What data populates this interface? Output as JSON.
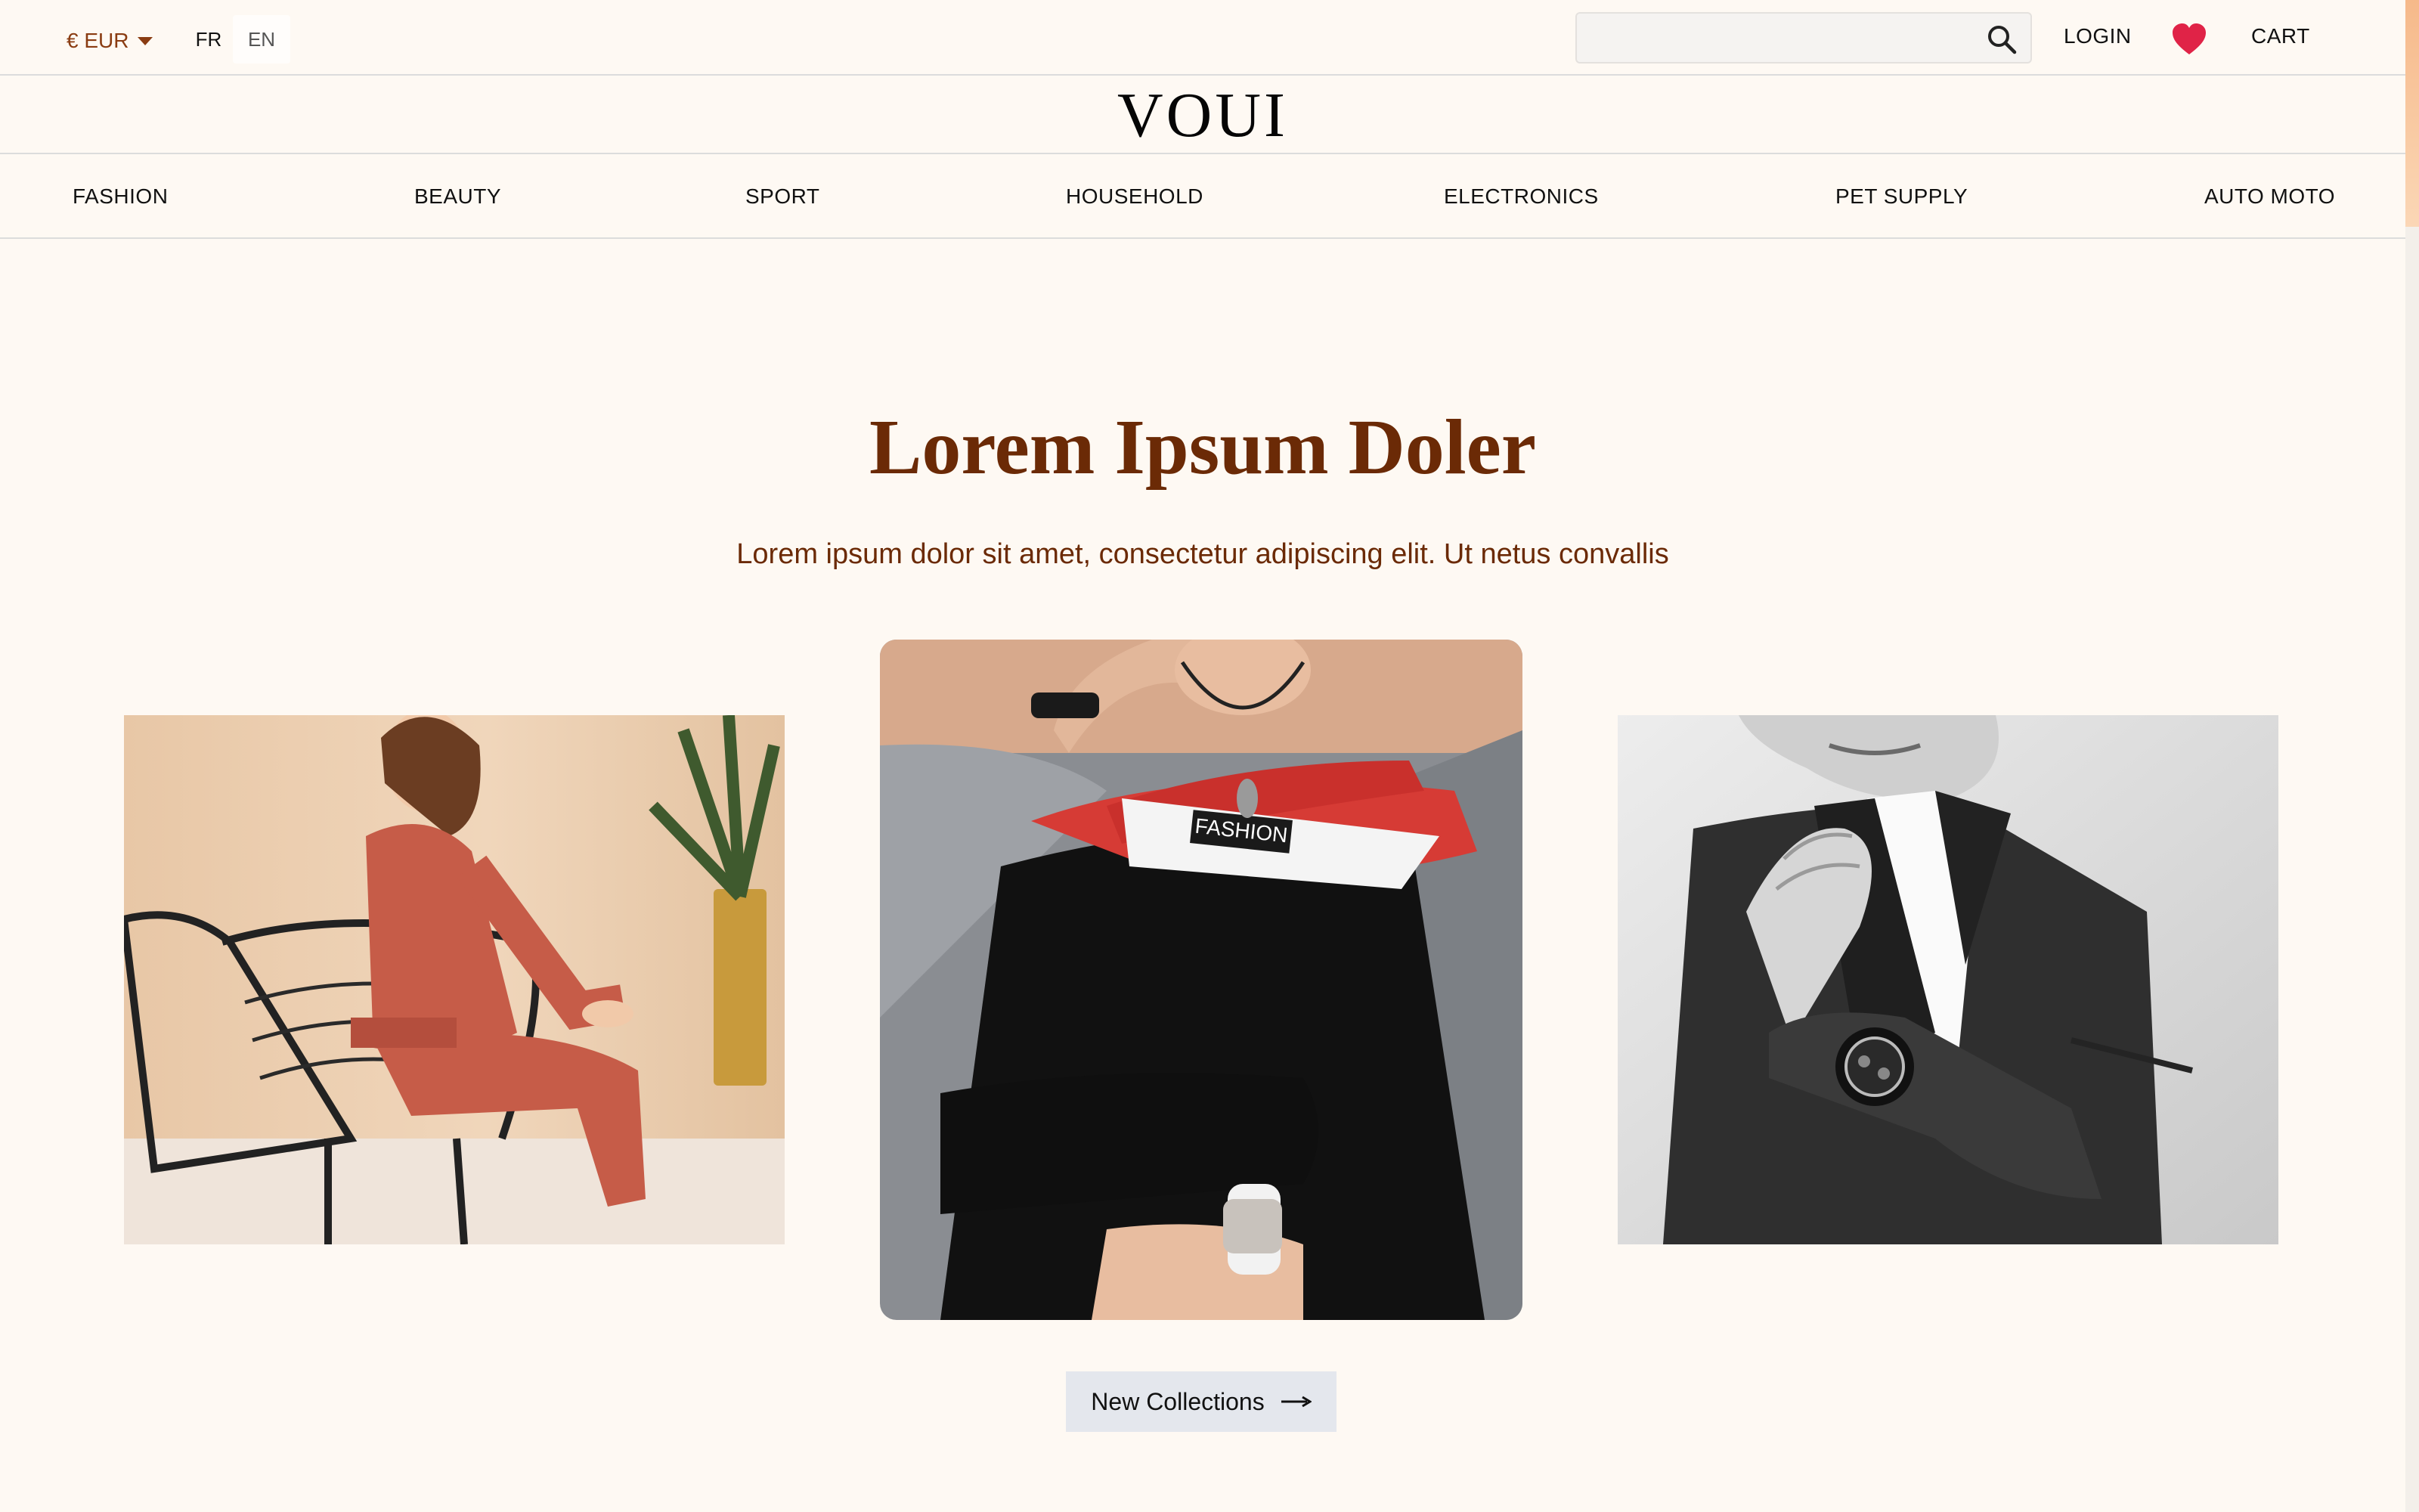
{
  "topbar": {
    "currency": "€ EUR",
    "languages": [
      "FR",
      "EN"
    ],
    "search": {
      "placeholder": "",
      "value": ""
    },
    "login_label": "LOGIN",
    "cart_label": "CART"
  },
  "brand": {
    "logo": "VOUI"
  },
  "categories": [
    "FASHION",
    "BEAUTY",
    "SPORT",
    "HOUSEHOLD",
    "ELECTRONICS",
    "PET SUPPLY",
    "AUTO MOTO"
  ],
  "hero": {
    "title": "Lorem Ipsum Doler",
    "subtitle": "Lorem ipsum dolor sit amet, consectetur adipiscing elit. Ut netus convallis",
    "center_photo_print": "FASHION",
    "cta_label": "New Collections"
  },
  "icons": {
    "search": "search-icon",
    "wishlist": "heart-icon",
    "currency_dropdown": "caret-down-icon",
    "cta_arrow": "arrow-right-icon"
  },
  "colors": {
    "background": "#fef9f3",
    "accent_brown": "#6b2a06",
    "currency_brown": "#8a3c12",
    "heart_red": "#e02347",
    "cta_bg": "#e4e7ed"
  }
}
